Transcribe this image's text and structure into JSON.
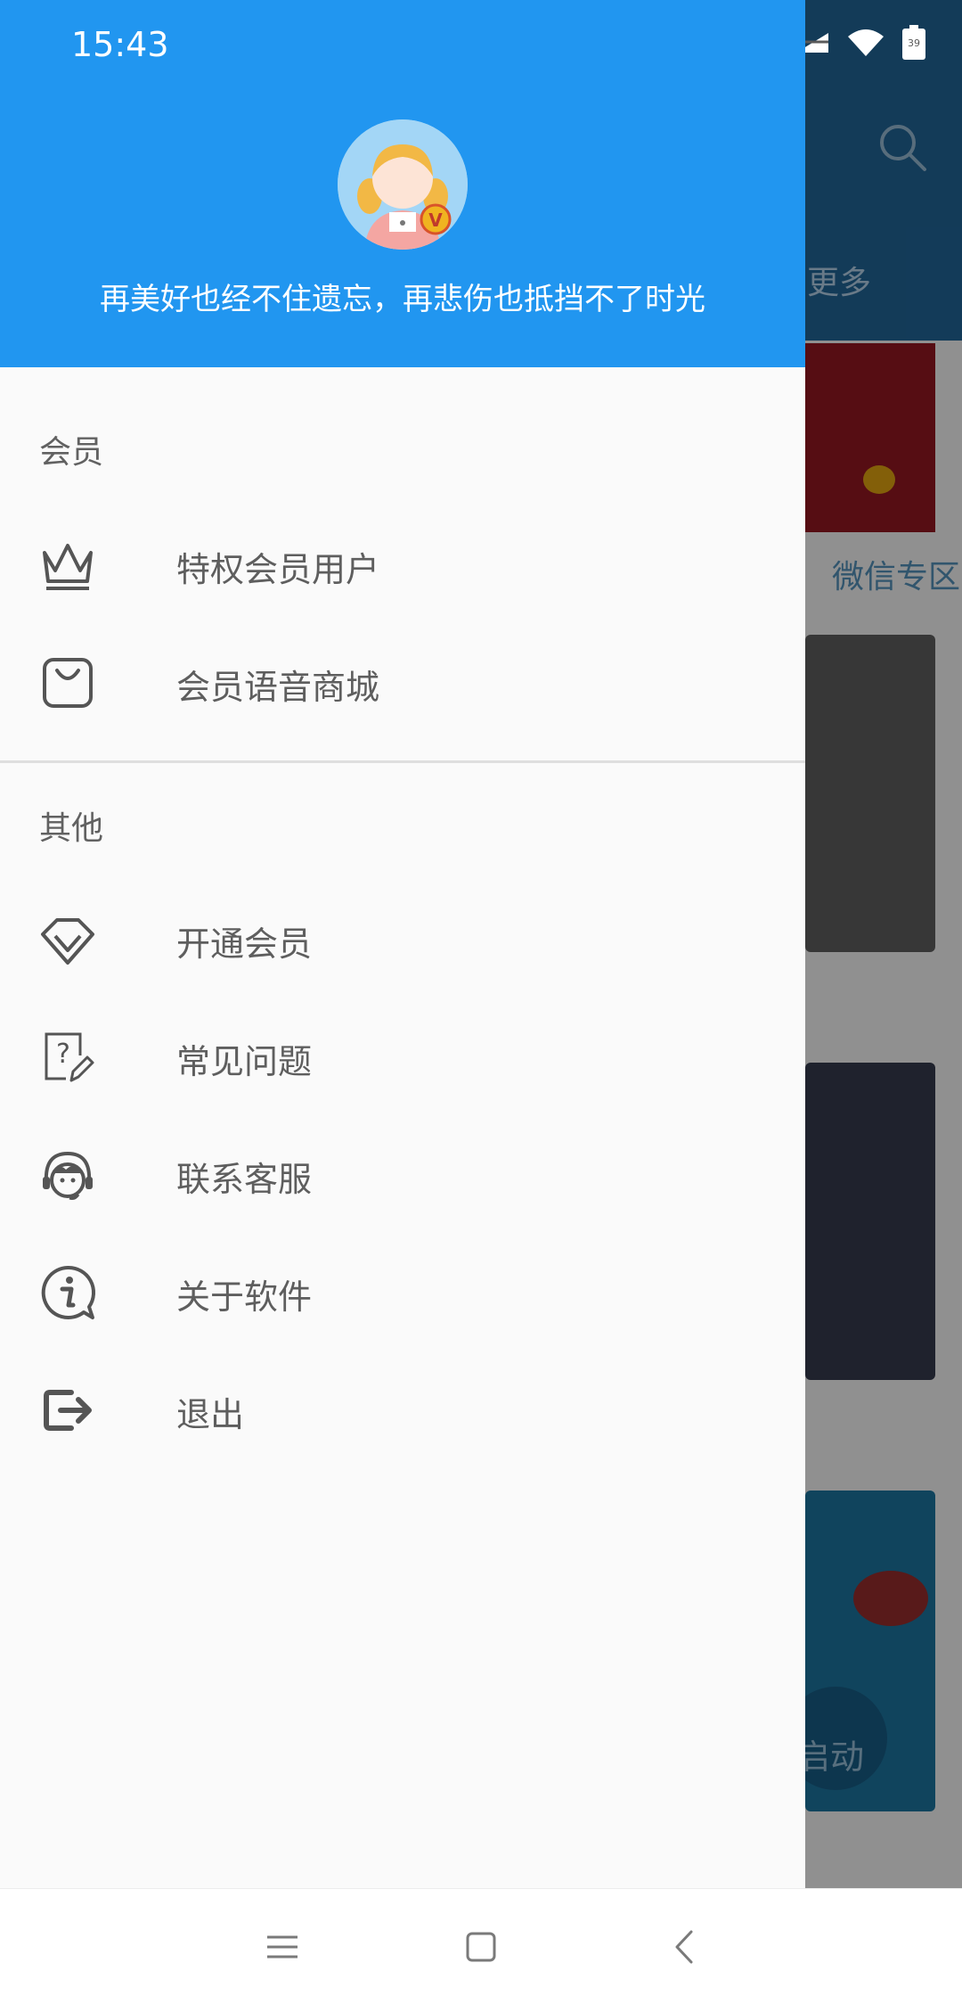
{
  "status_bar": {
    "time": "15:43",
    "battery": "39"
  },
  "drawer": {
    "motto": "再美好也经不住遗忘，再悲伤也抵挡不了时光",
    "sections": [
      {
        "title": "会员",
        "items": [
          {
            "label": "特权会员用户",
            "icon": "crown-icon"
          },
          {
            "label": "会员语音商城",
            "icon": "shopping-bag-icon"
          }
        ]
      },
      {
        "title": "其他",
        "items": [
          {
            "label": "开通会员",
            "icon": "diamond-icon"
          },
          {
            "label": "常见问题",
            "icon": "question-edit-icon"
          },
          {
            "label": "联系客服",
            "icon": "headset-agent-icon"
          },
          {
            "label": "关于软件",
            "icon": "info-bubble-icon"
          },
          {
            "label": "退出",
            "icon": "logout-icon"
          }
        ]
      }
    ]
  },
  "background": {
    "more_label": "更多",
    "wechat_label": "微信专区",
    "start_label": "启动"
  },
  "colors": {
    "header": "#2196f0",
    "drawer_bg": "#fafafa",
    "label": "#5e5e5e"
  }
}
